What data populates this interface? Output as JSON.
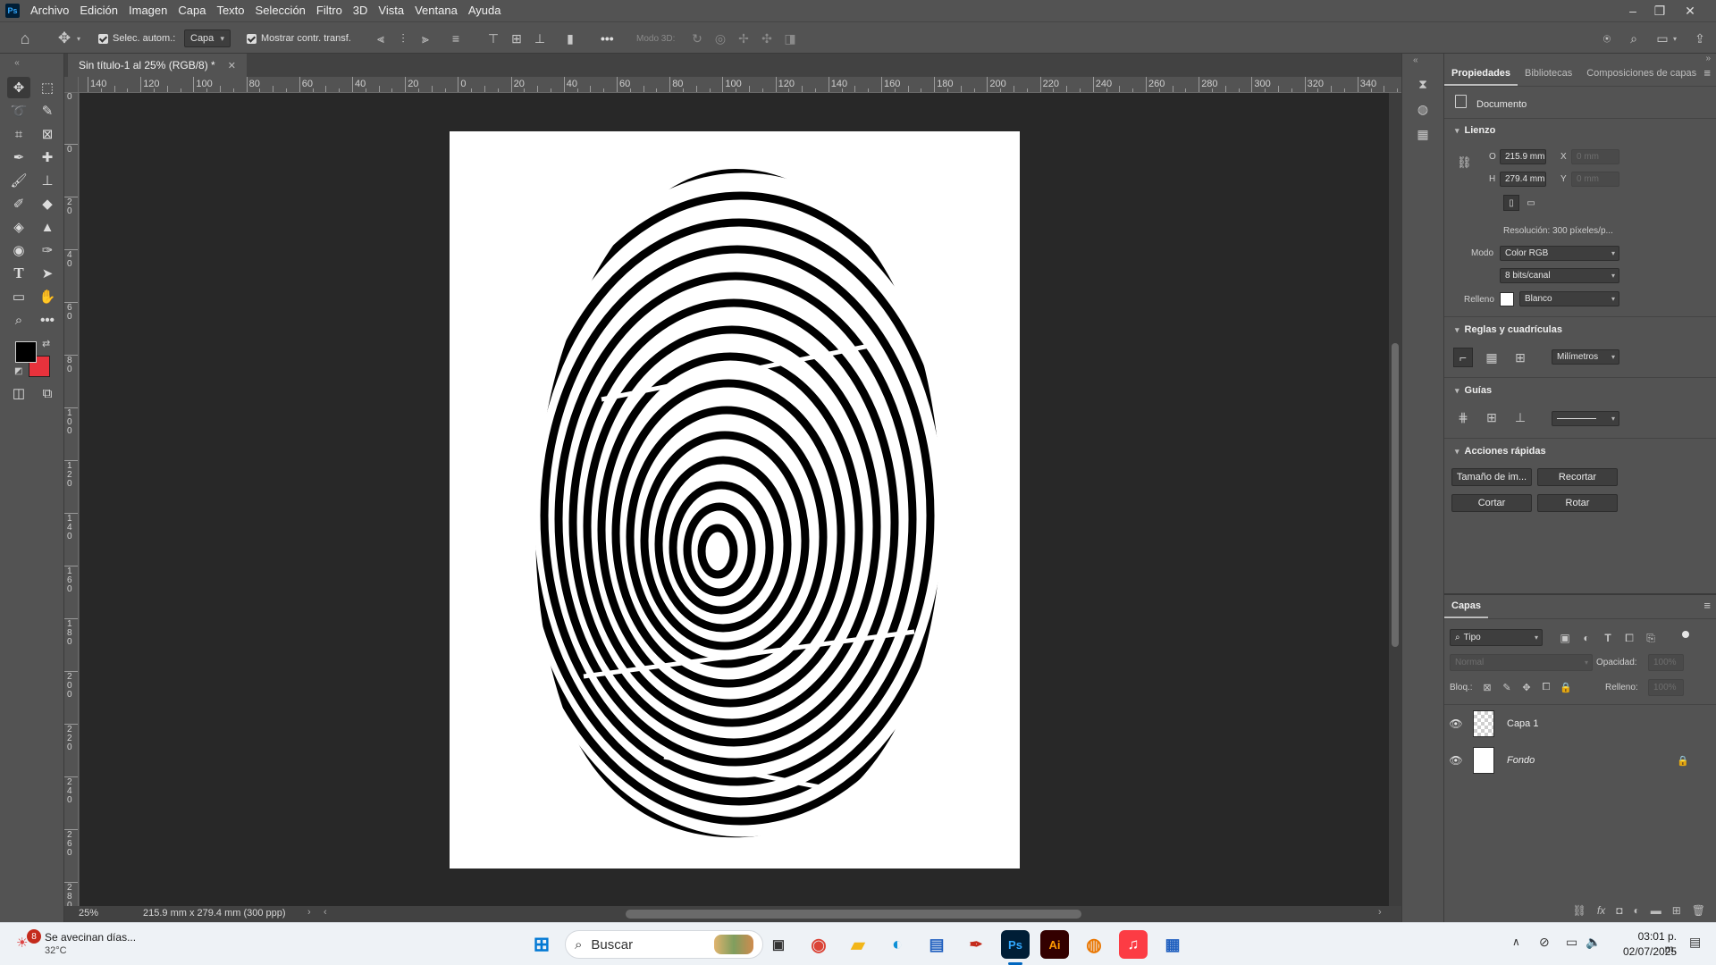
{
  "app": {
    "logo": "Ps",
    "menu": [
      "Archivo",
      "Edición",
      "Imagen",
      "Capa",
      "Texto",
      "Selección",
      "Filtro",
      "3D",
      "Vista",
      "Ventana",
      "Ayuda"
    ]
  },
  "options_bar": {
    "auto_select_label": "Selec. autom.:",
    "auto_select_target": "Capa",
    "show_transform_label": "Mostrar contr. transf.",
    "mode_3d_label": "Modo 3D:",
    "more": "•••"
  },
  "document": {
    "tab_title": "Sin título-1 al 25% (RGB/8) *",
    "zoom": "25%",
    "doc_info": "215.9 mm x 279.4 mm (300 ppp)"
  },
  "ruler": {
    "h_labels": [
      "140",
      "120",
      "100",
      "80",
      "60",
      "40",
      "20",
      "0",
      "20",
      "40",
      "60",
      "80",
      "100",
      "120",
      "140",
      "160",
      "180",
      "200",
      "220",
      "240",
      "260",
      "280",
      "300",
      "320",
      "340"
    ],
    "v_labels": [
      "0",
      "0",
      "2\n0",
      "4\n0",
      "6\n0",
      "8\n0",
      "1\n0\n0",
      "1\n2\n0",
      "1\n4\n0",
      "1\n6\n0",
      "1\n8\n0",
      "2\n0\n0",
      "2\n2\n0",
      "2\n4\n0",
      "2\n6\n0",
      "2\n8\n0"
    ]
  },
  "properties": {
    "tabs": [
      "Propiedades",
      "Bibliotecas",
      "Composiciones de capas"
    ],
    "doc_label": "Documento",
    "canvas": {
      "title": "Lienzo",
      "w_label": "O",
      "w_value": "215.9 mm",
      "h_label": "H",
      "h_value": "279.4 mm",
      "x_label": "X",
      "x_value": "0 mm",
      "y_label": "Y",
      "y_value": "0 mm",
      "resolution": "Resolución:  300 píxeles/p...",
      "mode_label": "Modo",
      "mode_value": "Color RGB",
      "depth_value": "8 bits/canal",
      "fill_label": "Relleno",
      "fill_value": "Blanco"
    },
    "rulers": {
      "title": "Reglas y cuadrículas",
      "units": "Milímetros"
    },
    "guides": {
      "title": "Guías"
    },
    "quick_actions": {
      "title": "Acciones rápidas",
      "buttons": [
        "Tamaño de im...",
        "Recortar",
        "Cortar",
        "Rotar"
      ]
    }
  },
  "layers": {
    "title": "Capas",
    "filter_kind": "Tipo",
    "blend_mode": "Normal",
    "opacity_label": "Opacidad:",
    "opacity_value": "100%",
    "lock_label": "Bloq.:",
    "fill_label": "Relleno:",
    "fill_value": "100%",
    "items": [
      {
        "name": "Capa 1",
        "visible": true
      },
      {
        "name": "Fondo",
        "visible": true,
        "locked": true
      }
    ]
  },
  "taskbar": {
    "weather_badge": "8",
    "weather_title": "Se avecinan días...",
    "weather_temp": "32°C",
    "search_placeholder": "Buscar",
    "time": "03:01 p. m.",
    "date": "02/07/2025"
  },
  "colors": {
    "foreground": "#000000",
    "background": "#e8323c",
    "accent": "#31a8ff"
  }
}
